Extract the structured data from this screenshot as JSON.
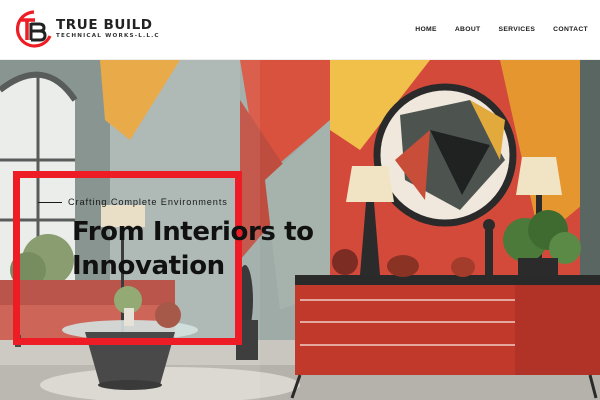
{
  "brand": {
    "name": "TRUE BUILD",
    "subtitle": "TECHNICAL WORKS-L.L.C",
    "monogram": "TB",
    "colors": {
      "primary": "#ee1c24",
      "dark": "#222222"
    }
  },
  "nav": {
    "items": [
      {
        "label": "HOME"
      },
      {
        "label": "ABOUT"
      },
      {
        "label": "SERVICES"
      },
      {
        "label": "CONTACT"
      }
    ]
  },
  "hero": {
    "tagline": "Crafting Complete Environments",
    "headline_line1": "From Interiors to",
    "headline_line2": "Innovation",
    "frame_color": "#ee1c24",
    "background_image": "interior-living-room-illustration"
  }
}
